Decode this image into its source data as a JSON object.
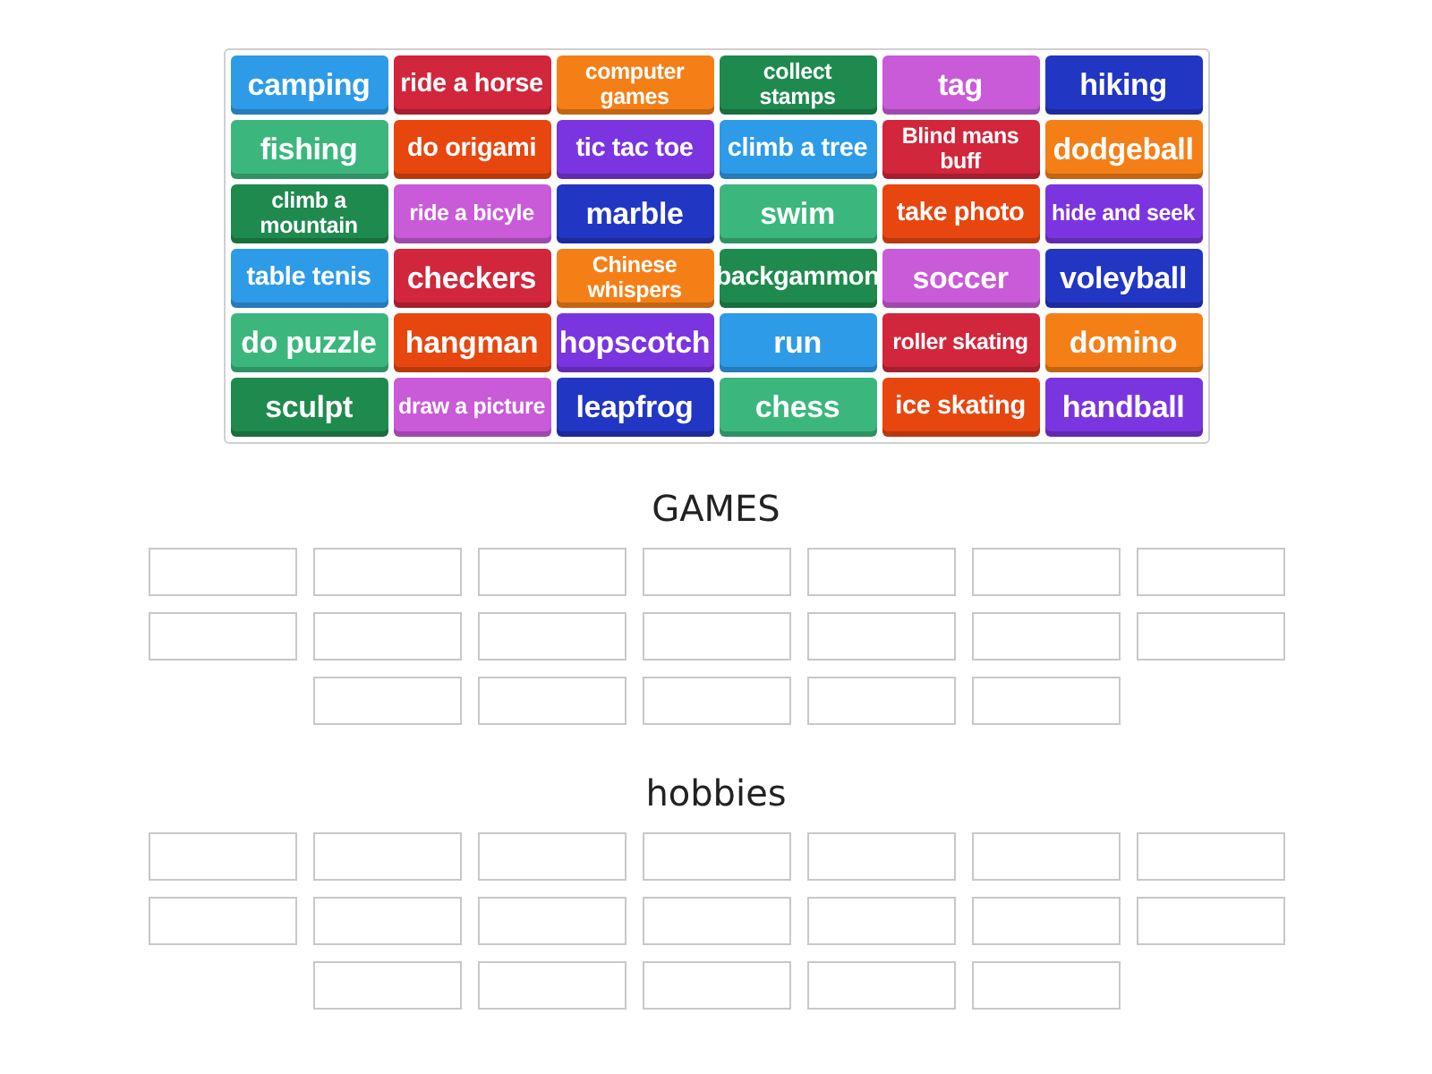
{
  "tiles": [
    {
      "label": "camping",
      "color": "#2d9be8"
    },
    {
      "label": "ride a horse",
      "color": "#d1263b"
    },
    {
      "label": "computer games",
      "color": "#f57f17"
    },
    {
      "label": "collect stamps",
      "color": "#1e8a4e"
    },
    {
      "label": "tag",
      "color": "#c95ad8"
    },
    {
      "label": "hiking",
      "color": "#2236c4"
    },
    {
      "label": "fishing",
      "color": "#3bb77e"
    },
    {
      "label": "do origami",
      "color": "#e8460f"
    },
    {
      "label": "tic tac toe",
      "color": "#7b35e0"
    },
    {
      "label": "climb a tree",
      "color": "#2d9be8"
    },
    {
      "label": "Blind mans buff",
      "color": "#d1263b"
    },
    {
      "label": "dodgeball",
      "color": "#f57f17"
    },
    {
      "label": "climb a mountain",
      "color": "#1e8a4e"
    },
    {
      "label": "ride a bicyle",
      "color": "#c95ad8"
    },
    {
      "label": "marble",
      "color": "#2236c4"
    },
    {
      "label": "swim",
      "color": "#3bb77e"
    },
    {
      "label": "take photo",
      "color": "#e8460f"
    },
    {
      "label": "hide and seek",
      "color": "#7b35e0"
    },
    {
      "label": "table tenis",
      "color": "#2d9be8"
    },
    {
      "label": "checkers",
      "color": "#d1263b"
    },
    {
      "label": "Chinese whispers",
      "color": "#f57f17"
    },
    {
      "label": "backgammon",
      "color": "#1e8a4e"
    },
    {
      "label": "soccer",
      "color": "#c95ad8"
    },
    {
      "label": "voleyball",
      "color": "#2236c4"
    },
    {
      "label": "do puzzle",
      "color": "#3bb77e"
    },
    {
      "label": "hangman",
      "color": "#e8460f"
    },
    {
      "label": "hopscotch",
      "color": "#7b35e0"
    },
    {
      "label": "run",
      "color": "#2d9be8"
    },
    {
      "label": "roller skating",
      "color": "#d1263b"
    },
    {
      "label": "domino",
      "color": "#f57f17"
    },
    {
      "label": "sculpt",
      "color": "#1e8a4e"
    },
    {
      "label": "draw a picture",
      "color": "#c95ad8"
    },
    {
      "label": "leapfrog",
      "color": "#2236c4"
    },
    {
      "label": "chess",
      "color": "#3bb77e"
    },
    {
      "label": "ice skating",
      "color": "#e8460f"
    },
    {
      "label": "handball",
      "color": "#7b35e0"
    }
  ],
  "groups": [
    {
      "title": "GAMES"
    },
    {
      "title": "hobbies"
    }
  ]
}
